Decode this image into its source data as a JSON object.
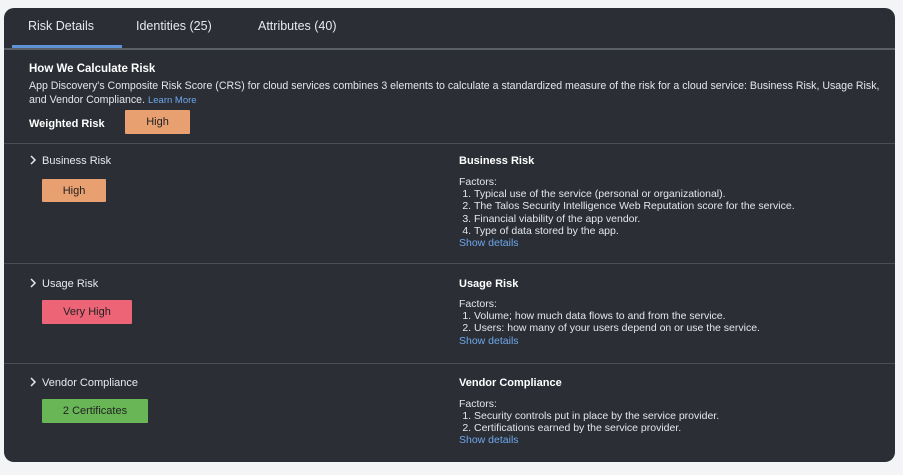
{
  "tabs": [
    {
      "label": "Risk Details"
    },
    {
      "label": "Identities (25)"
    },
    {
      "label": "Attributes (40)"
    }
  ],
  "intro": {
    "heading": "How We Calculate Risk",
    "text": "App Discovery's Composite Risk Score (CRS) for cloud services combines 3 elements to calculate a standardized measure of the risk for a cloud service: Business Risk, Usage Risk, and Vendor Compliance.",
    "learn_more": "Learn More"
  },
  "weighted_risk": {
    "label": "Weighted Risk",
    "value": "High",
    "color": "#e9a071"
  },
  "sections": [
    {
      "title": "Business Risk",
      "badge": "High",
      "badge_color": "#e9a071",
      "right_title": "Business Risk",
      "factors_label": "Factors:",
      "factors": [
        "Typical use of the service (personal or organizational).",
        "The Talos Security Intelligence Web Reputation score for the service.",
        "Financial viability of the app vendor.",
        "Type of data stored by the app."
      ],
      "show_details": "Show details"
    },
    {
      "title": "Usage Risk",
      "badge": "Very High",
      "badge_color": "#ec6476",
      "right_title": "Usage Risk",
      "factors_label": "Factors:",
      "factors": [
        "Volume; how much data flows to and from the service.",
        "Users: how many of your users depend on or use the service."
      ],
      "show_details": "Show details"
    },
    {
      "title": "Vendor Compliance",
      "badge": "2 Certificates",
      "badge_color": "#69b657",
      "right_title": "Vendor Compliance",
      "factors_label": "Factors:",
      "factors": [
        "Security controls put in place by the service provider.",
        "Certifications earned by the service provider."
      ],
      "show_details": "Show details"
    }
  ],
  "colors": {
    "accent": "#5e93d6",
    "link": "#6ea6ec",
    "panel": "#2b2f35"
  }
}
